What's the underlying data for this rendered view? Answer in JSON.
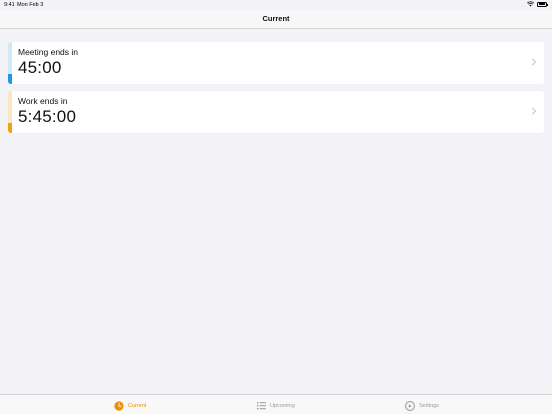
{
  "status_bar": {
    "time": "9:41",
    "date": "Mon Feb 3"
  },
  "nav": {
    "title": "Current"
  },
  "timers": [
    {
      "label": "Meeting ends in",
      "time": "45:00",
      "color_light": "#cfe9f7",
      "color_dark": "#1e9be0",
      "progress": 0.25
    },
    {
      "label": "Work ends in",
      "time": "5:45:00",
      "color_light": "#fbe6c2",
      "color_dark": "#f0a30a",
      "progress": 0.25
    }
  ],
  "tabs": [
    {
      "label": "Current",
      "icon": "clock-icon",
      "active": true
    },
    {
      "label": "Upcoming",
      "icon": "list-icon",
      "active": false
    },
    {
      "label": "Settings",
      "icon": "settings-icon",
      "active": false
    }
  ],
  "colors": {
    "accent": "#f08c00",
    "inactive": "#9a9aa0"
  }
}
